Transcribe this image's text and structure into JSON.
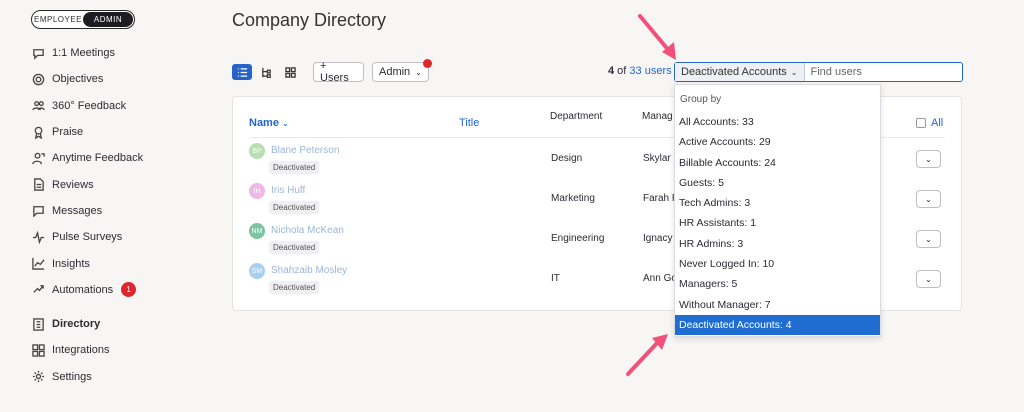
{
  "mode_toggle": {
    "employee": "EMPLOYEE",
    "admin": "ADMIN"
  },
  "sidebar": {
    "items": [
      {
        "label": "1:1 Meetings",
        "icon": "chat-bubble-icon"
      },
      {
        "label": "Objectives",
        "icon": "target-icon"
      },
      {
        "label": "360° Feedback",
        "icon": "people-icon"
      },
      {
        "label": "Praise",
        "icon": "ribbon-icon"
      },
      {
        "label": "Anytime Feedback",
        "icon": "person-feedback-icon"
      },
      {
        "label": "Reviews",
        "icon": "document-icon"
      },
      {
        "label": "Messages",
        "icon": "message-icon"
      },
      {
        "label": "Pulse Surveys",
        "icon": "pulse-icon"
      },
      {
        "label": "Insights",
        "icon": "chart-icon"
      },
      {
        "label": "Automations",
        "icon": "automation-icon",
        "badge": "1"
      },
      {
        "label": "Directory",
        "icon": "directory-icon"
      },
      {
        "label": "Integrations",
        "icon": "grid-icon"
      },
      {
        "label": "Settings",
        "icon": "gear-icon"
      }
    ]
  },
  "header": {
    "title": "Company Directory",
    "add_users": "+ Users",
    "admin": "Admin",
    "count_shown": "4",
    "count_of": " of ",
    "count_total": "33 users",
    "filter_selected": "Deactivated Accounts",
    "find_placeholder": "Find users"
  },
  "table": {
    "columns": {
      "name": "Name",
      "title": "Title",
      "department": "Department",
      "manager": "Manag",
      "all": "All"
    },
    "rows": [
      {
        "initials": "BP",
        "name": "Blane Peterson",
        "status": "Deactivated",
        "department": "Design",
        "manager": "Skylar C",
        "avatar_color": "#b6e0b0"
      },
      {
        "initials": "IH",
        "name": "Iris Huff",
        "status": "Deactivated",
        "department": "Marketing",
        "manager": "Farah F",
        "avatar_color": "#f0b8e8"
      },
      {
        "initials": "NM",
        "name": "Nichola McKean",
        "status": "Deactivated",
        "department": "Engineering",
        "manager": "Ignacy",
        "avatar_color": "#7cc4a2"
      },
      {
        "initials": "SM",
        "name": "Shahzaib Mosley",
        "status": "Deactivated",
        "department": "IT",
        "manager": "Ann Go",
        "avatar_color": "#a8cff0"
      }
    ]
  },
  "group_menu": {
    "header": "Group by",
    "items": [
      "All Accounts: 33",
      "Active Accounts: 29",
      "Billable Accounts: 24",
      "Guests: 5",
      "Tech Admins: 3",
      "HR Assistants: 1",
      "HR Admins: 3",
      "Never Logged In: 10",
      "Managers: 5",
      "Without Manager: 7",
      "Deactivated Accounts: 4"
    ],
    "selected_index": 10
  },
  "colors": {
    "accent": "#2266cc",
    "selected": "#1f6dd1",
    "badge": "#e0252b",
    "arrow": "#f0507a"
  }
}
